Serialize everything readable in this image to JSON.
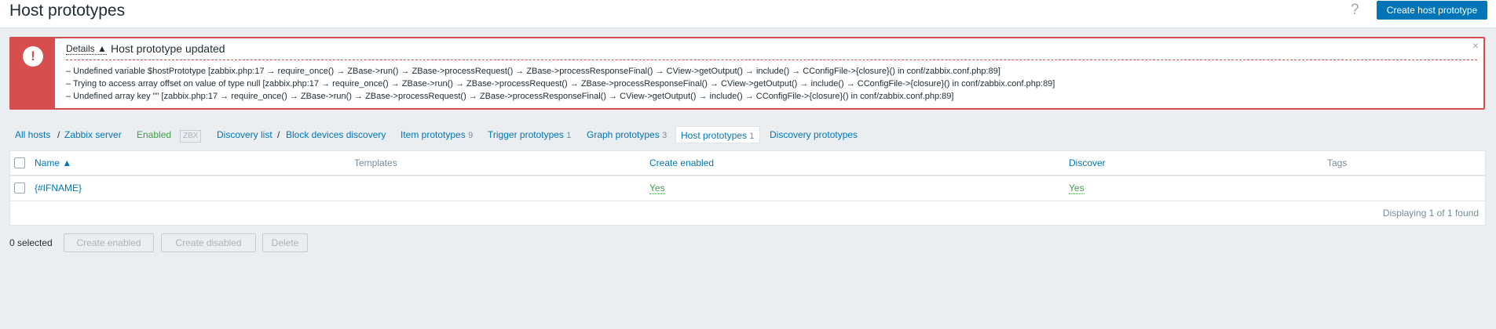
{
  "header": {
    "title": "Host prototypes",
    "help_glyph": "?",
    "create_button": "Create host prototype"
  },
  "message": {
    "icon_glyph": "!",
    "details_label": "Details ▲",
    "title": "Host prototype updated",
    "close_glyph": "×",
    "lines": [
      "– Undefined variable $hostPrototype [zabbix.php:17 → require_once() → ZBase->run() → ZBase->processRequest() → ZBase->processResponseFinal() → CView->getOutput() → include() → CConfigFile->{closure}() in conf/zabbix.conf.php:89]",
      "– Trying to access array offset on value of type null [zabbix.php:17 → require_once() → ZBase->run() → ZBase->processRequest() → ZBase->processResponseFinal() → CView->getOutput() → include() → CConfigFile->{closure}() in conf/zabbix.conf.php:89]",
      "– Undefined array key \"\" [zabbix.php:17 → require_once() → ZBase->run() → ZBase->processRequest() → ZBase->processResponseFinal() → CView->getOutput() → include() → CConfigFile->{closure}() in conf/zabbix.conf.php:89]"
    ]
  },
  "nav": {
    "all_hosts": "All hosts",
    "separator": "/",
    "host": "Zabbix server",
    "status": "Enabled",
    "zbx": "ZBX",
    "discovery_list": "Discovery list",
    "discovery_rule": "Block devices discovery",
    "tabs": [
      {
        "label": "Item prototypes",
        "count": "9"
      },
      {
        "label": "Trigger prototypes",
        "count": "1"
      },
      {
        "label": "Graph prototypes",
        "count": "3"
      },
      {
        "label": "Host prototypes",
        "count": "1"
      },
      {
        "label": "Discovery prototypes",
        "count": ""
      }
    ]
  },
  "table": {
    "columns": {
      "name": "Name ▲",
      "templates": "Templates",
      "create_enabled": "Create enabled",
      "discover": "Discover",
      "tags": "Tags"
    },
    "rows": [
      {
        "name": "{#IFNAME}",
        "templates": "",
        "create_enabled": "Yes",
        "discover": "Yes",
        "tags": ""
      }
    ],
    "footer": "Displaying 1 of 1 found"
  },
  "actions": {
    "selected": "0 selected",
    "create_enabled": "Create enabled",
    "create_disabled": "Create disabled",
    "delete": "Delete"
  },
  "colors": {
    "primary": "#0275b8",
    "error": "#d64e4e",
    "success": "#429e47",
    "background": "#ebeef0"
  }
}
